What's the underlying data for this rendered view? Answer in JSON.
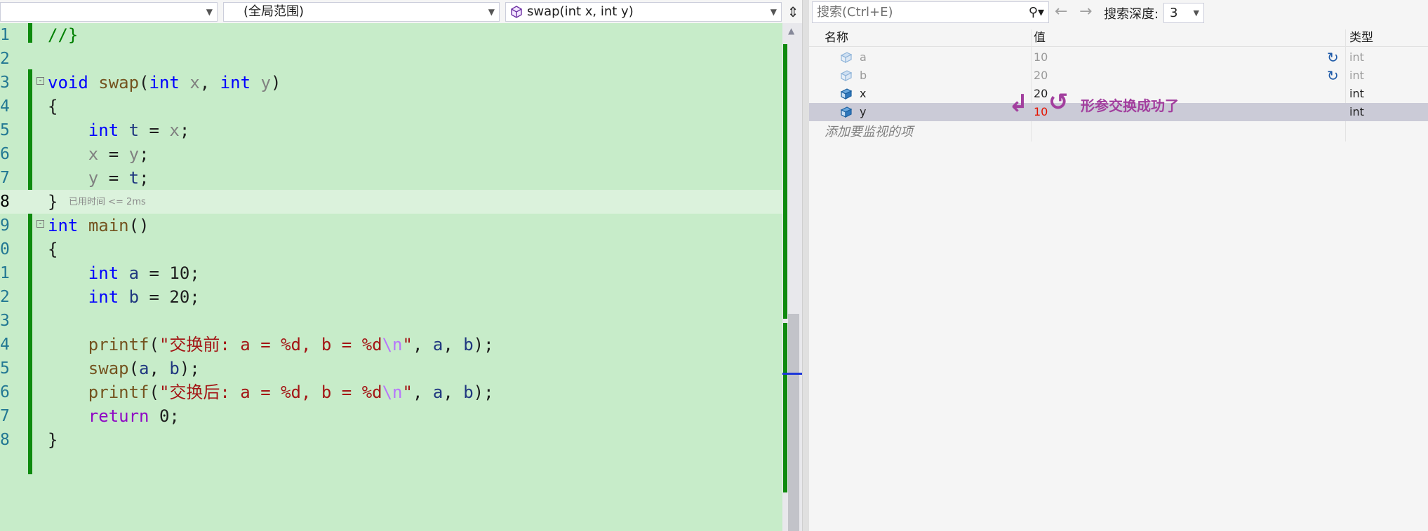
{
  "editor_toolbar": {
    "combo1": "",
    "combo2": "(全局范围)",
    "combo3": "swap(int x, int y)"
  },
  "code_lines": [
    {
      "n": "1"
    },
    {
      "n": "2"
    },
    {
      "n": "3"
    },
    {
      "n": "4"
    },
    {
      "n": "5"
    },
    {
      "n": "6"
    },
    {
      "n": "7"
    },
    {
      "n": "8"
    },
    {
      "n": "9"
    },
    {
      "n": "0"
    },
    {
      "n": "1"
    },
    {
      "n": "2"
    },
    {
      "n": "3"
    },
    {
      "n": "4"
    },
    {
      "n": "5"
    },
    {
      "n": "6"
    },
    {
      "n": "7"
    },
    {
      "n": "8"
    }
  ],
  "elapsed_hint": "已用时间 <= 2ms",
  "watch": {
    "search_placeholder": "搜索(Ctrl+E)",
    "depth_label": "搜索深度:",
    "depth_value": "3",
    "columns": {
      "name": "名称",
      "value": "值",
      "type": "类型"
    },
    "rows": [
      {
        "name": "a",
        "value": "10",
        "type": "int"
      },
      {
        "name": "b",
        "value": "20",
        "type": "int"
      },
      {
        "name": "x",
        "value": "20",
        "type": "int"
      },
      {
        "name": "y",
        "value": "10",
        "type": "int"
      }
    ],
    "add_item": "添加要监视的项",
    "annotation": "形参交换成功了"
  }
}
